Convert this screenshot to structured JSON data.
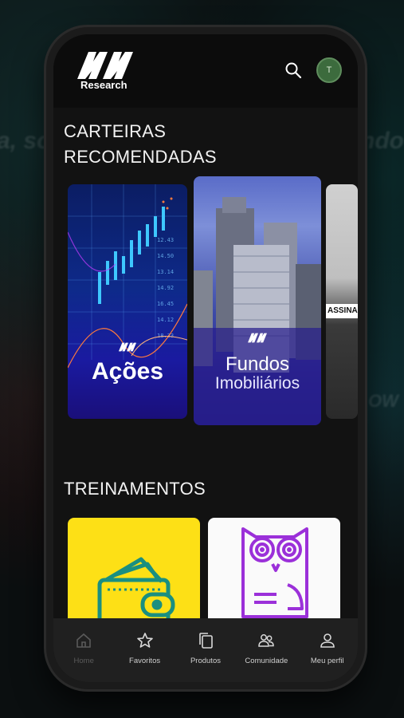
{
  "header": {
    "logo_text": "Research",
    "avatar_initial": "T"
  },
  "background_text": {
    "line1": "a, sou",
    "line2": "ndo",
    "line3": "OW"
  },
  "carteiras": {
    "title_line1": "CARTEIRAS",
    "title_line2": "RECOMENDADAS",
    "cards": [
      {
        "label": "Ações"
      },
      {
        "label_line1": "Fundos",
        "label_line2": "Imobiliários"
      },
      {
        "ribbon": "ASSINA"
      }
    ],
    "ticker_values": [
      "12.43",
      "14.50",
      "13.14",
      "14.92",
      "16.45",
      "14.12",
      "18.33"
    ]
  },
  "treinamentos": {
    "title": "TREINAMENTOS"
  },
  "nav": {
    "items": [
      {
        "label": "Home",
        "icon": "home-icon"
      },
      {
        "label": "Favoritos",
        "icon": "star-icon"
      },
      {
        "label": "Produtos",
        "icon": "copy-icon"
      },
      {
        "label": "Comunidade",
        "icon": "people-icon"
      },
      {
        "label": "Meu perfil",
        "icon": "user-icon"
      }
    ]
  },
  "colors": {
    "accent_green": "#3c6b3d",
    "train_yellow": "#fde016",
    "owl_purple": "#9b30d9",
    "wallet_teal": "#1a8f80"
  }
}
